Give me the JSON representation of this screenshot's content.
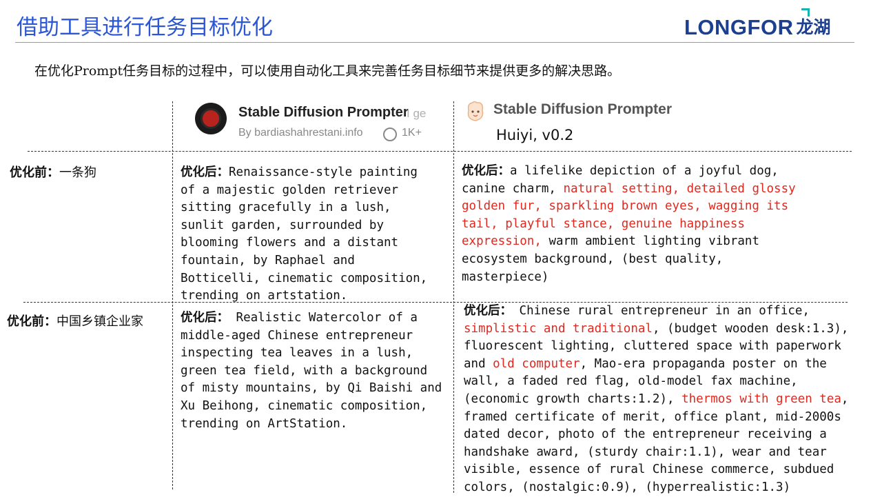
{
  "header": {
    "title": "借助工具进行任务目标优化",
    "logo_latin": "LONGFOR",
    "logo_cn": "龙湖"
  },
  "intro": "在优化Prompt任务目标的过程中，可以使用自动化工具来完善任务目标细节来提供更多的解决思路。",
  "tools": {
    "left": {
      "name": "Stable Diffusion Prompter",
      "name_cut": "I ge",
      "by": "By bardiashahrestani.info",
      "count": "1K+"
    },
    "right": {
      "name": "Stable Diffusion Prompter",
      "version": "Huiyi, v0.2"
    }
  },
  "rows": [
    {
      "before_label": "优化前：",
      "before_text": "一条狗",
      "after_label": "优化后：",
      "left_lines": [
        "Renaissance-style painting",
        "of a majestic golden retriever",
        "sitting gracefully in a lush,",
        "sunlit garden, surrounded by",
        "blooming flowers and a distant",
        "fountain, by Raphael and",
        "Botticelli, cinematic composition,",
        "trending on artstation."
      ],
      "right_lines": [
        [
          {
            "t": "a lifelike depiction of a joyful dog,",
            "red": false
          }
        ],
        [
          {
            "t": "canine charm, ",
            "red": false
          },
          {
            "t": "natural setting, detailed glossy",
            "red": true
          }
        ],
        [
          {
            "t": "golden fur, sparkling brown eyes, wagging its",
            "red": true
          }
        ],
        [
          {
            "t": "tail, playful stance, genuine happiness",
            "red": true
          }
        ],
        [
          {
            "t": "expression,",
            "red": true
          },
          {
            "t": " warm ambient lighting vibrant",
            "red": false
          }
        ],
        [
          {
            "t": "ecosystem background, (best quality,",
            "red": false
          }
        ],
        [
          {
            "t": "masterpiece)",
            "red": false
          }
        ]
      ]
    },
    {
      "before_label": "优化前：",
      "before_text": "中国乡镇企业家",
      "after_label": "优化后：",
      "left_lines": [
        " Realistic Watercolor of a",
        "middle-aged Chinese entrepreneur",
        "inspecting tea leaves in a lush,",
        "green tea field, with a background",
        "of misty mountains, by Qi Baishi and",
        "Xu Beihong, cinematic composition,",
        "trending on ArtStation."
      ],
      "right_lines": [
        [
          {
            "t": " Chinese rural entrepreneur in an office,",
            "red": false
          }
        ],
        [
          {
            "t": "simplistic and traditional",
            "red": true
          },
          {
            "t": ", (budget wooden desk:1.3),",
            "red": false
          }
        ],
        [
          {
            "t": "fluorescent lighting, cluttered space with paperwork",
            "red": false
          }
        ],
        [
          {
            "t": "and ",
            "red": false
          },
          {
            "t": "old computer",
            "red": true
          },
          {
            "t": ", Mao-era propaganda poster on the",
            "red": false
          }
        ],
        [
          {
            "t": "wall, a faded red flag, old-model fax machine,",
            "red": false
          }
        ],
        [
          {
            "t": "(economic growth charts:1.2), ",
            "red": false
          },
          {
            "t": "thermos with green tea",
            "red": true
          },
          {
            "t": ",",
            "red": false
          }
        ],
        [
          {
            "t": "framed certificate of merit, office plant, mid-2000s",
            "red": false
          }
        ],
        [
          {
            "t": "dated decor, photo of the entrepreneur receiving a",
            "red": false
          }
        ],
        [
          {
            "t": "handshake award, (sturdy chair:1.1), wear and tear",
            "red": false
          }
        ],
        [
          {
            "t": "visible, essence of rural Chinese commerce, subdued",
            "red": false
          }
        ],
        [
          {
            "t": "colors, (nostalgic:0.9), (hyperrealistic:1.3)",
            "red": false
          }
        ]
      ]
    }
  ],
  "colors": {
    "title": "#2b57d6",
    "logo": "#1c3f8f",
    "highlight": "#e0281e",
    "accent": "#17b3b3"
  }
}
